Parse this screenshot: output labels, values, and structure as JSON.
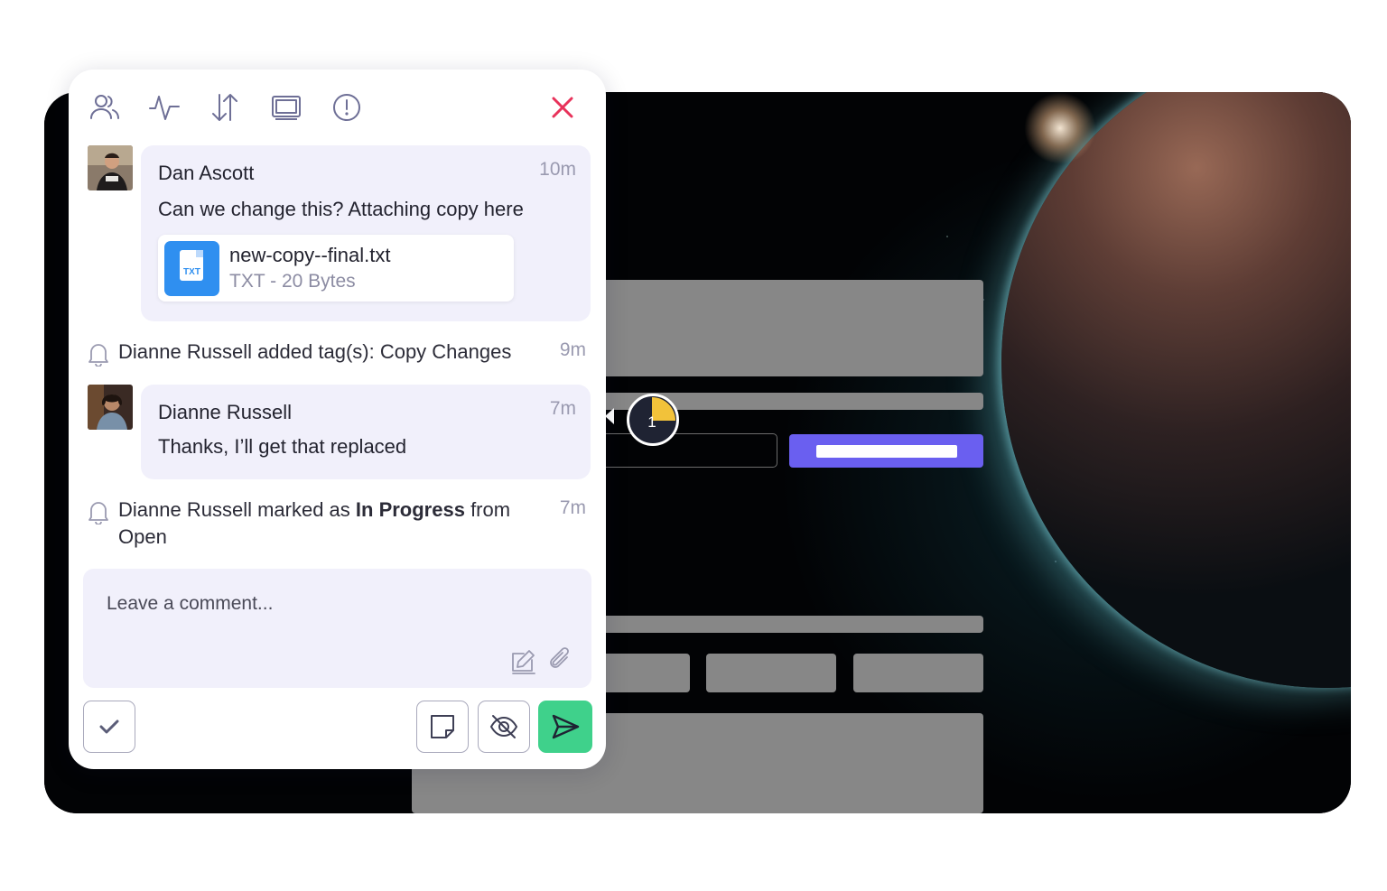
{
  "toolbar": {
    "icons": [
      "users-icon",
      "activity-icon",
      "sort-arrows-icon",
      "screen-icon",
      "info-icon",
      "close-icon"
    ],
    "close_color": "#e8325a"
  },
  "thread": [
    {
      "author": "Dan Ascott",
      "time": "10m",
      "text": "Can we change this? Attaching copy here",
      "attachment": {
        "name": "new-copy--final.txt",
        "meta": "TXT - 20 Bytes",
        "ext": "TXT"
      }
    },
    {
      "author": "Dianne Russell",
      "time": "7m",
      "text": "Thanks, I’ll get that replaced"
    }
  ],
  "activities": [
    {
      "text": "Dianne Russell added tag(s): Copy Changes",
      "time": "9m"
    },
    {
      "prefix": "Dianne Russell marked as ",
      "status": "In Progress",
      "suffix": " from",
      "line2": "Open",
      "time": "7m"
    }
  ],
  "composer": {
    "placeholder": "Leave a comment..."
  },
  "pin": {
    "number": "1",
    "progress_fraction": 0.25,
    "progress_color": "#f2c23a"
  },
  "colors": {
    "accent": "#6a5ff0",
    "send": "#3fd18b",
    "bubble": "#f1f0fb",
    "file_icon": "#2f8ff0"
  }
}
